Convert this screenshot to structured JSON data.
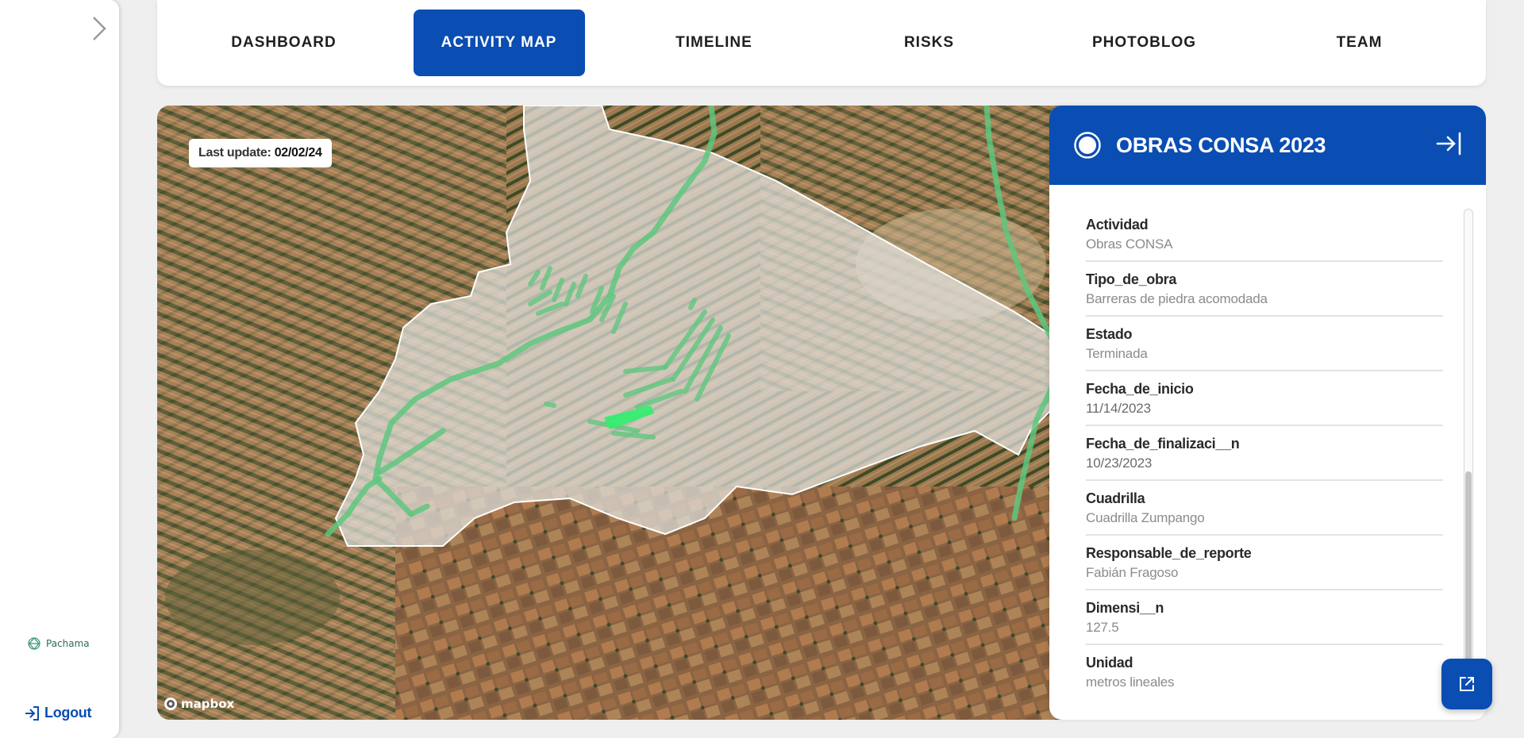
{
  "sidebar": {
    "brand_label": "Pachama",
    "logout_label": "Logout"
  },
  "tabs": [
    {
      "label": "DASHBOARD",
      "active": false
    },
    {
      "label": "ACTIVITY MAP",
      "active": true
    },
    {
      "label": "TIMELINE",
      "active": false
    },
    {
      "label": "RISKS",
      "active": false
    },
    {
      "label": "PHOTOBLOG",
      "active": false
    },
    {
      "label": "TEAM",
      "active": false
    }
  ],
  "map": {
    "last_update_label": "Last update:",
    "last_update_value": "02/02/24",
    "attribution": "mapbox"
  },
  "panel": {
    "title": "OBRAS CONSA 2023",
    "fields": [
      {
        "label": "Actividad",
        "value": "Obras CONSA"
      },
      {
        "label": "Tipo_de_obra",
        "value": "Barreras de piedra acomodada"
      },
      {
        "label": "Estado",
        "value": "Terminada"
      },
      {
        "label": "Fecha_de_inicio",
        "value": "11/14/2023"
      },
      {
        "label": "Fecha_de_finalizaci__n",
        "value": "10/23/2023"
      },
      {
        "label": "Cuadrilla",
        "value": "Cuadrilla Zumpango"
      },
      {
        "label": "Responsable_de_reporte",
        "value": "Fabián Fragoso"
      },
      {
        "label": "Dimensi__n",
        "value": "127.5"
      },
      {
        "label": "Unidad",
        "value": "metros lineales"
      }
    ]
  },
  "colors": {
    "accent": "#0a4db3",
    "route_green": "#5fc77e"
  },
  "icons": {
    "collapse": "chevron-right-icon",
    "brand": "pachama-logo-icon",
    "logout": "logout-icon",
    "panel_status": "circle-icon",
    "panel_close": "collapse-right-icon",
    "fab": "open-external-icon"
  }
}
